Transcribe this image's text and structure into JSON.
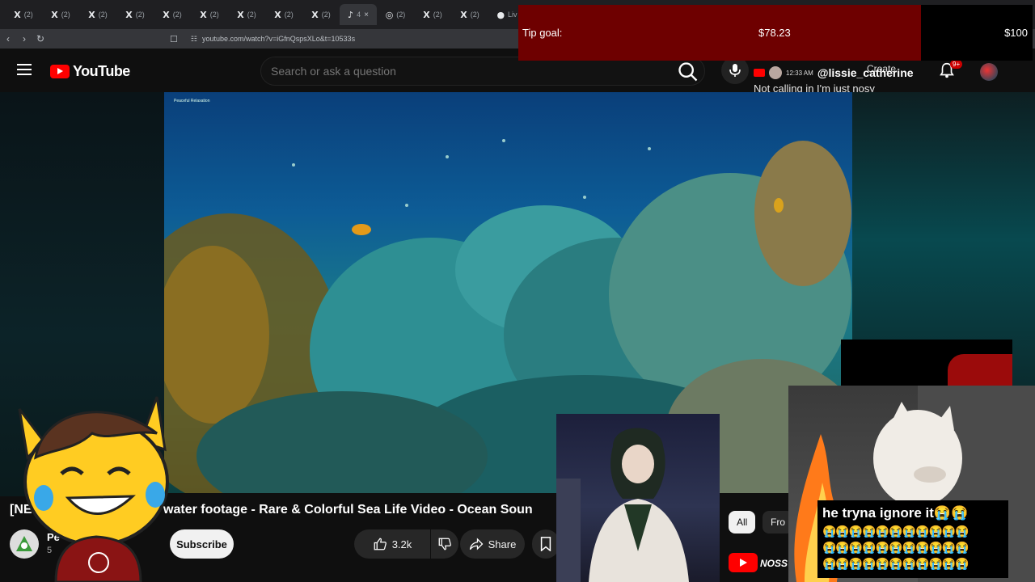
{
  "browser": {
    "tabs": [
      {
        "icon": "x-logo-icon",
        "label": "(2)"
      },
      {
        "icon": "x-logo-icon",
        "label": "(2)"
      },
      {
        "icon": "x-logo-icon",
        "label": "(2)"
      },
      {
        "icon": "x-logo-icon",
        "label": "(2)"
      },
      {
        "icon": "x-logo-icon",
        "label": "(2)"
      },
      {
        "icon": "x-logo-icon",
        "label": "(2)"
      },
      {
        "icon": "x-logo-icon",
        "label": "(2)"
      },
      {
        "icon": "x-logo-icon",
        "label": "(2)"
      },
      {
        "icon": "x-logo-icon",
        "label": "(2)"
      },
      {
        "icon": "audio-icon",
        "label": "4"
      },
      {
        "icon": "globe-icon",
        "label": "(2)"
      },
      {
        "icon": "x-logo-icon",
        "label": "(2)"
      },
      {
        "icon": "x-logo-icon",
        "label": "(2)"
      },
      {
        "icon": "live-icon",
        "label": "Liv"
      }
    ],
    "address": "youtube.com/watch?v=iGfnQspsXLo&t=10533s"
  },
  "tip_goal": {
    "label": "Tip goal:",
    "current": "$78.23",
    "target": "$100",
    "progress_fraction": 0.7823,
    "fill_color": "#6e0000"
  },
  "youtube": {
    "logo_text": "YouTube",
    "search_placeholder": "Search or ask a question",
    "create_label": "Create",
    "notification_badge": "9+",
    "video_brand": "Peaceful Relaxation",
    "title_prefix": "[NE",
    "title": "water footage - Rare & Colorful Sea Life Video - Ocean Soun",
    "channel_name_fragment": "Pe",
    "subscriber_fragment": "5",
    "subscribe_label": "Subscribe",
    "like_count": "3.2k",
    "share_label": "Share",
    "chips": [
      "All",
      "Fro"
    ],
    "sidebar_channel": "NOSS"
  },
  "chat_overlay": {
    "time": "12:33 AM",
    "user": "@lissie_catherine",
    "message": "Not calling in I'm just nosy"
  },
  "dog_cam": {
    "caption": "he tryna ignore it😭😭",
    "emoji_rows": [
      "😭😭😭😭😭😭😭😭😭😭😭",
      "😭😭😭😭😭😭😭😭😭😭😭",
      "😭😭😭😭😭😭😭😭😭😭😭"
    ]
  },
  "colors": {
    "yt_red": "#ff0000",
    "background": "#0f0f0f",
    "tip_fill": "#6e0000"
  }
}
